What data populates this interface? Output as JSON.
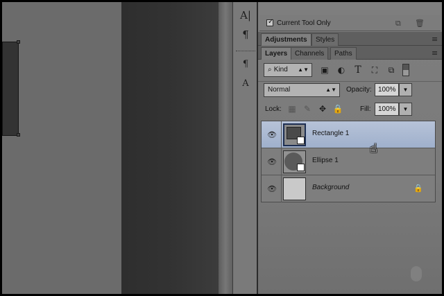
{
  "tool_options": {
    "current_tool_only_label": "Current Tool Only",
    "current_tool_only_checked": true
  },
  "tool_strip": {
    "icons": [
      "character-icon",
      "paragraph-icon",
      "paragraph-styles-icon",
      "character-styles-icon"
    ],
    "glyphs": [
      "A|",
      "¶",
      "¶",
      "A"
    ]
  },
  "panel_tabs_top": [
    {
      "label": "Adjustments",
      "active": true
    },
    {
      "label": "Styles",
      "active": false
    }
  ],
  "panel_tabs_layers": [
    {
      "label": "Layers",
      "active": true
    },
    {
      "label": "Channels",
      "active": false
    },
    {
      "label": "Paths",
      "active": false
    }
  ],
  "layers_panel": {
    "filter_kind": "Kind",
    "blend_mode": "Normal",
    "opacity_label": "Opacity:",
    "opacity_value": "100%",
    "lock_label": "Lock:",
    "fill_label": "Fill:",
    "fill_value": "100%",
    "layers": [
      {
        "name": "Rectangle 1",
        "selected": true,
        "italic": false,
        "locked": false,
        "thumb": "rectangle"
      },
      {
        "name": "Ellipse 1",
        "selected": false,
        "italic": false,
        "locked": false,
        "thumb": "ellipse"
      },
      {
        "name": "Background",
        "selected": false,
        "italic": true,
        "locked": true,
        "thumb": "plain"
      }
    ]
  },
  "colors": {
    "selection": "#a8b8d2",
    "panel": "#7e7e7e",
    "canvas_dark": "#333333"
  }
}
